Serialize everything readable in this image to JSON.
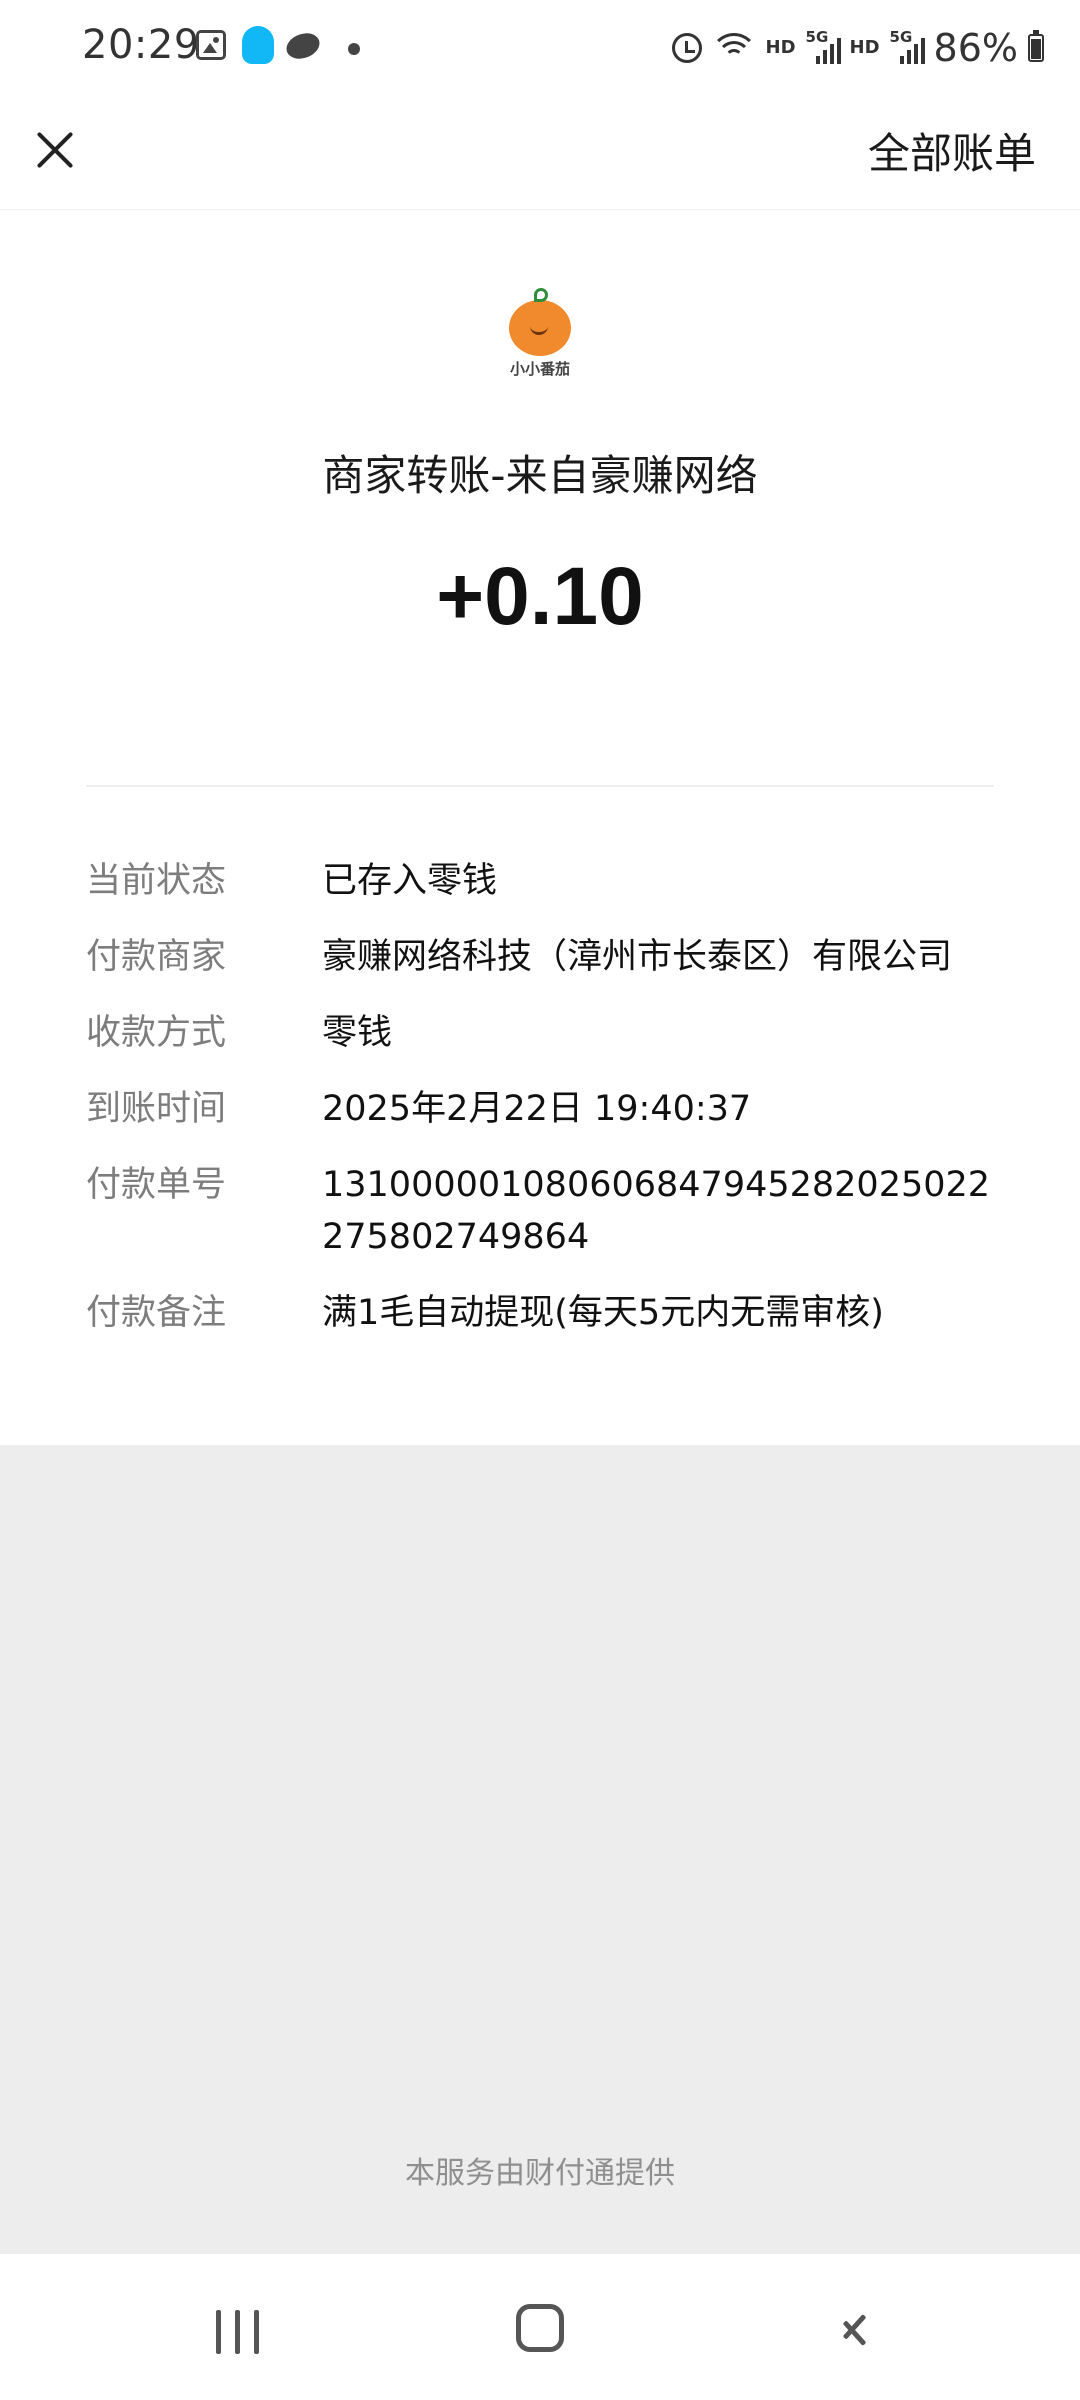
{
  "status_bar": {
    "time": "20:29",
    "battery": "86%",
    "network_label_1": "HD",
    "network_label_2": "HD",
    "signal_label_1": "5G",
    "signal_label_2": "5G",
    "icons": [
      "gallery-icon",
      "qq-icon",
      "planet-icon",
      "dot-icon",
      "alarm-icon",
      "wifi-icon",
      "signal-icon",
      "battery-icon"
    ]
  },
  "header": {
    "close_icon": "close-icon",
    "all_bills_label": "全部账单"
  },
  "merchant": {
    "logo_text": "小小番茄",
    "title": "商家转账-来自豪赚网络",
    "amount": "+0.10"
  },
  "details": [
    {
      "label": "当前状态",
      "value": "已存入零钱"
    },
    {
      "label": "付款商家",
      "value": "豪赚网络科技（漳州市长泰区）有限公司"
    },
    {
      "label": "收款方式",
      "value": "零钱"
    },
    {
      "label": "到账时间",
      "value": "2025年2月22日 19:40:37"
    },
    {
      "label": "付款单号",
      "value": "131000001080606847945282025022275802749864"
    },
    {
      "label": "付款备注",
      "value": "满1毛自动提现(每天5元内无需审核)"
    }
  ],
  "footer": {
    "provider_text": "本服务由财付通提供"
  },
  "nav": {
    "recents_icon": "recents-icon",
    "home_icon": "home-icon",
    "back_icon": "back-icon"
  }
}
